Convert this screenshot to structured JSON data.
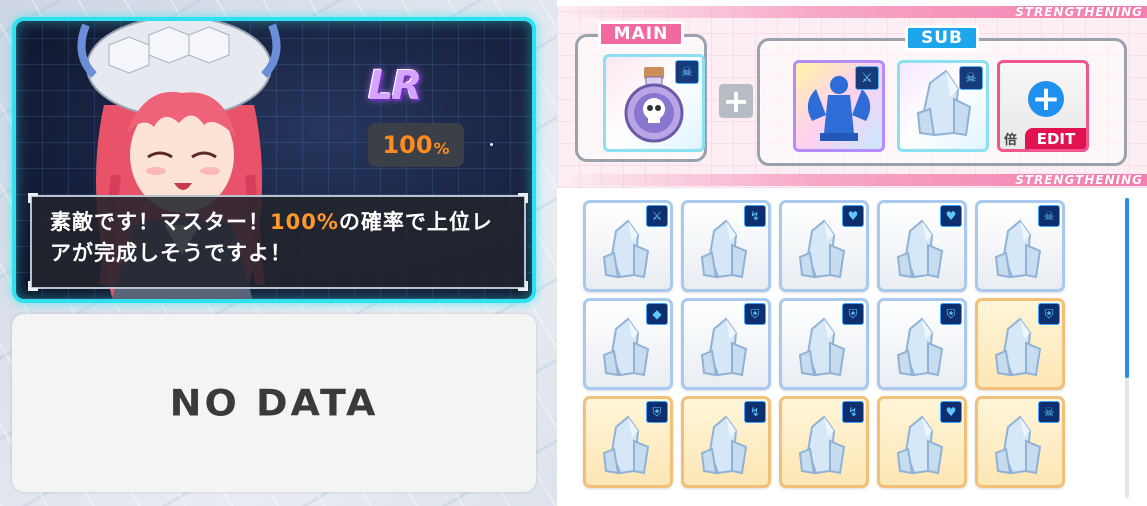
{
  "character": {
    "rarity": "LR",
    "success_rate_value": "100",
    "success_rate_unit": "%",
    "dialog_pre": "素敵です！マスター！",
    "dialog_highlight": "100%",
    "dialog_post": "の確率で上位レアが完成しそうですよ！"
  },
  "no_data": {
    "label": "NO DATA"
  },
  "strengthening": {
    "banner_label": "STRENGTHENING",
    "main_title": "MAIN",
    "sub_title": "SUB",
    "main_slot": {
      "item": "skull-potion",
      "badge_icon": "skull-icon"
    },
    "sub_slots": [
      {
        "item": "angel-statue",
        "badge_icon": "sword-icon"
      },
      {
        "item": "crystal",
        "badge_icon": "skull-icon"
      }
    ],
    "edit_slot": {
      "text": "倍",
      "button_label": "EDIT"
    }
  },
  "inventory": {
    "items": [
      {
        "badge": "sword-icon",
        "tier": "silver"
      },
      {
        "badge": "boomerang-icon",
        "tier": "silver"
      },
      {
        "badge": "heart-icon",
        "tier": "silver"
      },
      {
        "badge": "heart-icon",
        "tier": "silver"
      },
      {
        "badge": "skull-icon",
        "tier": "silver"
      },
      {
        "badge": "gem-icon",
        "tier": "silver"
      },
      {
        "badge": "shield-icon",
        "tier": "silver"
      },
      {
        "badge": "shield-icon",
        "tier": "silver"
      },
      {
        "badge": "shield-icon",
        "tier": "silver"
      },
      {
        "badge": "shield-icon",
        "tier": "gold"
      },
      {
        "badge": "shield-icon",
        "tier": "gold"
      },
      {
        "badge": "boomerang-icon",
        "tier": "gold"
      },
      {
        "badge": "boomerang-icon",
        "tier": "gold"
      },
      {
        "badge": "heart-icon",
        "tier": "gold"
      },
      {
        "badge": "skull-icon",
        "tier": "gold"
      }
    ]
  },
  "colors": {
    "accent_cyan": "#2fe0ee",
    "highlight_orange": "#ff9a2a",
    "main_pink": "#f06a9f",
    "sub_blue": "#1ea6ec",
    "edit_red": "#e0124f"
  }
}
